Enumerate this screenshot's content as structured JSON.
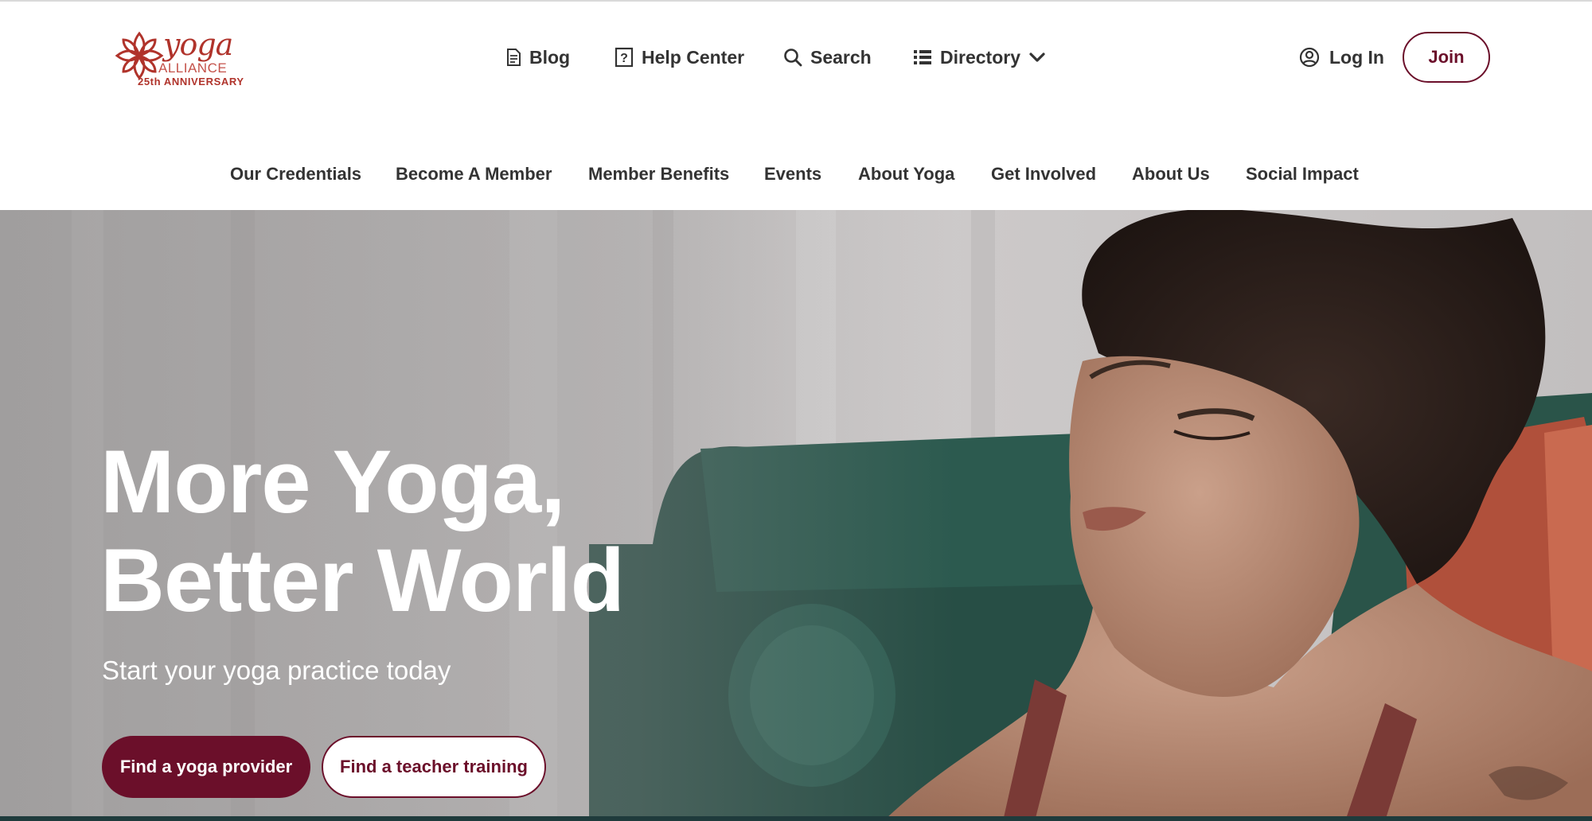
{
  "logo": {
    "word": "yoga",
    "sub": "ALLIANCE",
    "anniversary": "25th ANNIVERSARY"
  },
  "util_nav": {
    "blog": "Blog",
    "help_center": "Help Center",
    "search": "Search",
    "directory": "Directory"
  },
  "account": {
    "login": "Log In",
    "join": "Join"
  },
  "main_nav": {
    "items": [
      "Our Credentials",
      "Become A Member",
      "Member Benefits",
      "Events",
      "About Yoga",
      "Get Involved",
      "About Us",
      "Social Impact"
    ]
  },
  "hero": {
    "title_line1": "More Yoga,",
    "title_line2": "Better World",
    "subtitle": "Start your yoga practice today",
    "primary_cta": "Find a yoga provider",
    "secondary_cta": "Find a teacher training"
  },
  "colors": {
    "brand": "#6b0f2a",
    "logo": "#b0332b",
    "text": "#333333"
  }
}
